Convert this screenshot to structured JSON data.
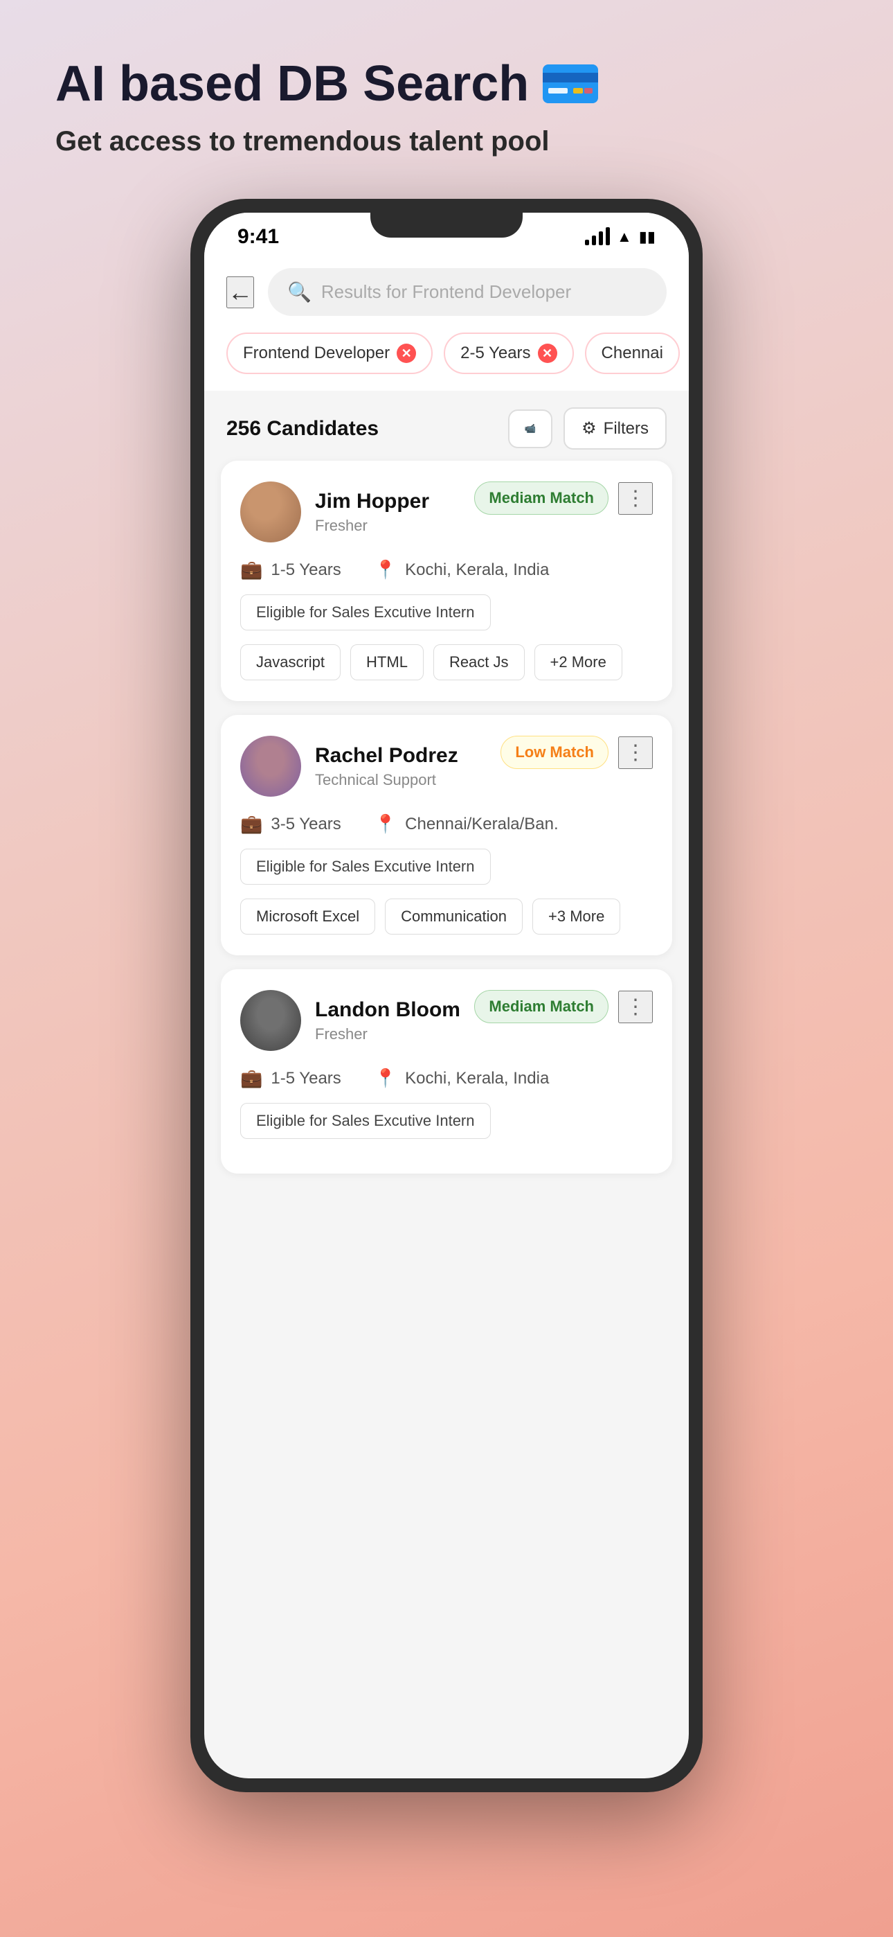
{
  "page": {
    "title": "AI based DB Search",
    "subtitle": "Get access to tremendous talent pool"
  },
  "status_bar": {
    "time": "9:41"
  },
  "search": {
    "placeholder": "Results for Frontend Developer"
  },
  "chips": [
    {
      "label": "Frontend Developer",
      "removable": true
    },
    {
      "label": "2-5 Years",
      "removable": true
    },
    {
      "label": "Chennai",
      "removable": false
    }
  ],
  "candidates_section": {
    "count": "256 Candidates",
    "filter_label": "Filters"
  },
  "candidates": [
    {
      "id": 1,
      "name": "Jim Hopper",
      "role": "Fresher",
      "match": "Mediam Match",
      "match_type": "medium",
      "experience": "1-5 Years",
      "location": "Kochi, Kerala, India",
      "eligible": "Eligible for Sales Excutive Intern",
      "skills": [
        "Javascript",
        "HTML",
        "React Js",
        "+2 More"
      ]
    },
    {
      "id": 2,
      "name": "Rachel Podrez",
      "role": "Technical Support",
      "match": "Low Match",
      "match_type": "low",
      "experience": "3-5 Years",
      "location": "Chennai/Kerala/Ban.",
      "eligible": "Eligible for Sales Excutive Intern",
      "skills": [
        "Microsoft Excel",
        "Communication",
        "+3 More"
      ]
    },
    {
      "id": 3,
      "name": "Landon Bloom",
      "role": "Fresher",
      "match": "Mediam Match",
      "match_type": "medium",
      "experience": "1-5 Years",
      "location": "Kochi, Kerala, India",
      "eligible": "Eligible for Sales Excutive Intern",
      "skills": []
    }
  ],
  "icons": {
    "back": "←",
    "search": "🔍",
    "more_vert": "⋮",
    "briefcase": "💼",
    "location": "📍",
    "filters": "⚙",
    "video": "📹"
  }
}
